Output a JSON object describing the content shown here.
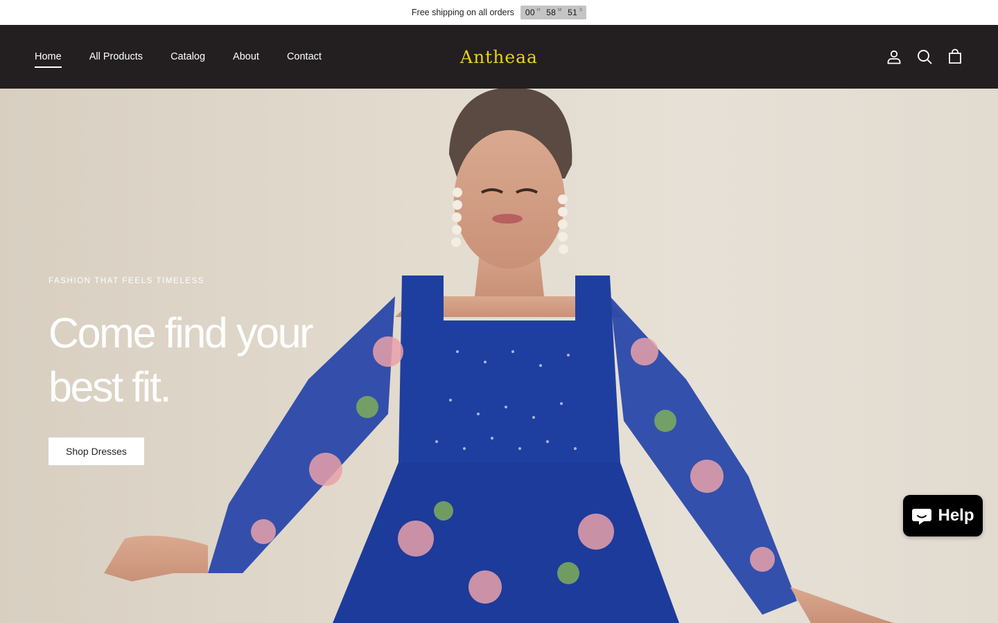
{
  "announcement": {
    "text": "Free shipping on all orders",
    "timer": {
      "hours": "00",
      "hours_unit": "H",
      "minutes": "58",
      "minutes_unit": "M",
      "seconds": "51",
      "seconds_unit": "S"
    }
  },
  "header": {
    "nav": [
      {
        "label": "Home",
        "active": true
      },
      {
        "label": "All Products"
      },
      {
        "label": "Catalog"
      },
      {
        "label": "About"
      },
      {
        "label": "Contact"
      }
    ],
    "logo": "Antheaa",
    "icons": [
      "account-icon",
      "search-icon",
      "cart-icon"
    ]
  },
  "hero": {
    "eyebrow": "FASHION THAT FEELS TIMELESS",
    "headline": "Come find your best fit.",
    "button_label": "Shop Dresses"
  },
  "chat": {
    "label": "Help",
    "icon": "chat-icon"
  },
  "colors": {
    "header_bg": "#231f20",
    "logo": "#e8d21a",
    "dress": "#1f3fa0",
    "chat_bg": "#000000"
  }
}
